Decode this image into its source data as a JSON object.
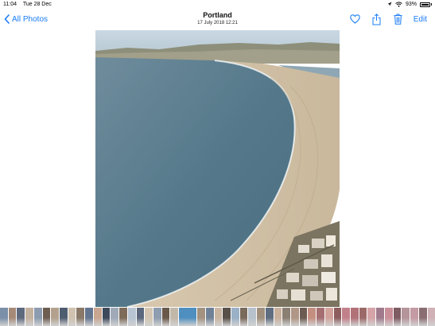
{
  "status_bar": {
    "time": "11:04",
    "date": "Tue 28 Dec",
    "battery": "93%",
    "icons": [
      "location-icon",
      "wifi-icon",
      "battery-icon"
    ]
  },
  "nav": {
    "back_label": "All Photos",
    "title": "Portland",
    "subtitle": "17 July 2018  12:21",
    "edit_label": "Edit",
    "icons": [
      "chevron-left-icon",
      "heart-icon",
      "share-icon",
      "trash-icon"
    ],
    "accent_color": "#1a7cf5"
  },
  "photo": {
    "subject": "beach-landscape"
  },
  "thumbnails": {
    "count": 50,
    "current_index": 21,
    "colors": [
      "#7b8fa8",
      "#a68a78",
      "#5d6a7e",
      "#c4b2a0",
      "#8c9bb0",
      "#6e5e52",
      "#b3a18e",
      "#4f5d70",
      "#d0c2b0",
      "#8a7868",
      "#647590",
      "#c9a690",
      "#3d4a5c",
      "#9fa9b8",
      "#7e6b5a",
      "#b8c4d2",
      "#5a677c",
      "#d4c6b2",
      "#8f9db0",
      "#6a5848",
      "#c2b8aa",
      "#4e8fc0",
      "#a3927f",
      "#6f8196",
      "#cbb6a2",
      "#59504a",
      "#9ab0c6",
      "#7a6a5c",
      "#b7c1cc",
      "#a08f7c",
      "#5f6d80",
      "#c9b09c",
      "#8b7e72",
      "#b09684",
      "#6c5b50",
      "#c48f80",
      "#a56f72",
      "#d1a39a",
      "#8e5e5e",
      "#c2818a",
      "#b17278",
      "#9b6a68",
      "#d5a3a8",
      "#a07a8c",
      "#c98e98",
      "#7e5c64",
      "#b5949a",
      "#c49aa4",
      "#8a6e72",
      "#d0b2b6"
    ]
  }
}
